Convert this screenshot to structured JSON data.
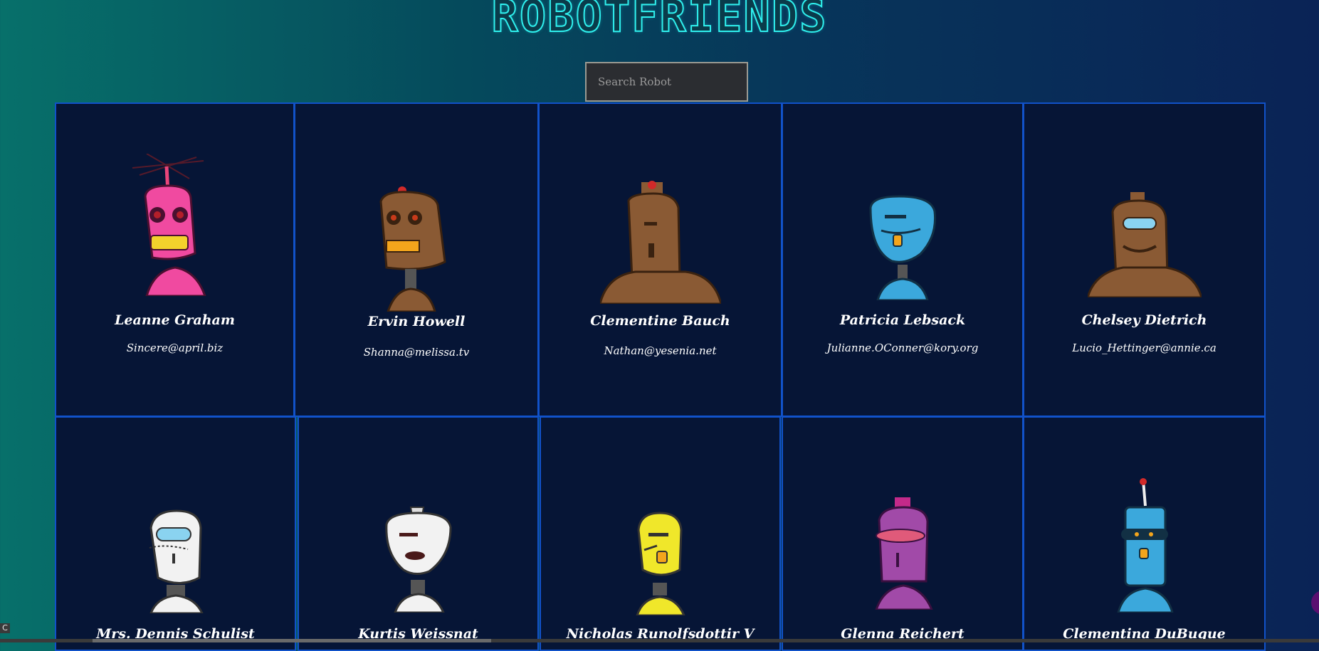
{
  "app": {
    "title": "ROBOTFRIENDS"
  },
  "search": {
    "placeholder": "Search Robot",
    "value": ""
  },
  "colors": {
    "card_bg": "#061536",
    "card_border": "#1152c9",
    "title_stroke": "#2ff0ee"
  },
  "robots": [
    {
      "name": "Leanne Graham",
      "email": "Sincere@april.biz"
    },
    {
      "name": "Ervin Howell",
      "email": "Shanna@melissa.tv"
    },
    {
      "name": "Clementine Bauch",
      "email": "Nathan@yesenia.net"
    },
    {
      "name": "Patricia Lebsack",
      "email": "Julianne.OConner@kory.org"
    },
    {
      "name": "Chelsey Dietrich",
      "email": "Lucio_Hettinger@annie.ca"
    },
    {
      "name": "Mrs. Dennis Schulist",
      "email": ""
    },
    {
      "name": "Kurtis Weissnat",
      "email": ""
    },
    {
      "name": "Nicholas Runolfsdottir V",
      "email": ""
    },
    {
      "name": "Glenna Reichert",
      "email": ""
    },
    {
      "name": "Clementina DuBuque",
      "email": ""
    }
  ],
  "status": {
    "corner_label": "C"
  }
}
